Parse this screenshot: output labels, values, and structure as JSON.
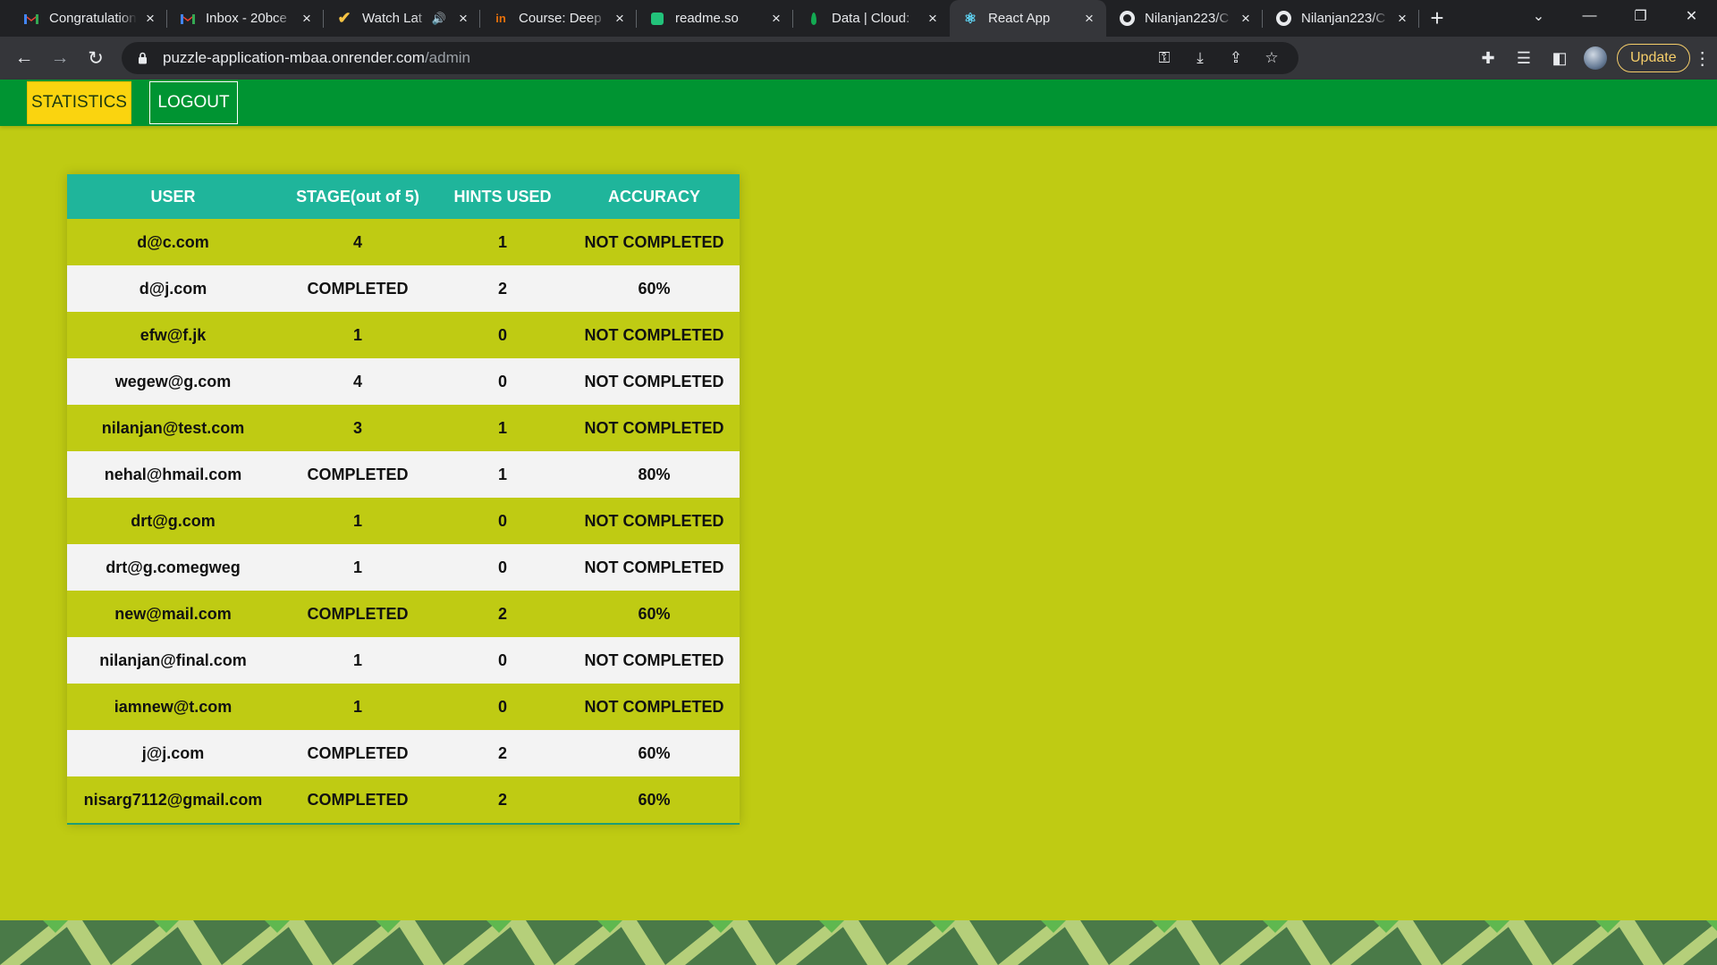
{
  "browser": {
    "tabs": [
      {
        "title": "Congratulation",
        "favicon": "gmail-icon"
      },
      {
        "title": "Inbox - 20bce",
        "favicon": "gmail-icon"
      },
      {
        "title": "Watch Lat",
        "favicon": "check-icon",
        "audio": "🔊"
      },
      {
        "title": "Course: Deep",
        "favicon": "course-icon"
      },
      {
        "title": "readme.so",
        "favicon": "readme-icon"
      },
      {
        "title": "Data | Cloud: ",
        "favicon": "mongodb-leaf-icon"
      },
      {
        "title": "React App",
        "favicon": "react-icon",
        "active": true
      },
      {
        "title": "Nilanjan223/C",
        "favicon": "github-icon"
      },
      {
        "title": "Nilanjan223/C",
        "favicon": "github-icon"
      }
    ],
    "address": {
      "host": "puzzle-application-mbaa.onrender.com",
      "path": "/admin"
    },
    "update_label": "Update"
  },
  "nav": {
    "statistics_label": "STATISTICS",
    "logout_label": "LOGOUT"
  },
  "table": {
    "headers": [
      "USER",
      "STAGE(out of 5)",
      "HINTS USED",
      "ACCURACY"
    ],
    "rows": [
      {
        "user": "d@c.com",
        "stage": "4",
        "hints": "1",
        "accuracy": "NOT COMPLETED"
      },
      {
        "user": "d@j.com",
        "stage": "COMPLETED",
        "hints": "2",
        "accuracy": "60%"
      },
      {
        "user": "efw@f.jk",
        "stage": "1",
        "hints": "0",
        "accuracy": "NOT COMPLETED"
      },
      {
        "user": "wegew@g.com",
        "stage": "4",
        "hints": "0",
        "accuracy": "NOT COMPLETED"
      },
      {
        "user": "nilanjan@test.com",
        "stage": "3",
        "hints": "1",
        "accuracy": "NOT COMPLETED"
      },
      {
        "user": "nehal@hmail.com",
        "stage": "COMPLETED",
        "hints": "1",
        "accuracy": "80%"
      },
      {
        "user": "drt@g.com",
        "stage": "1",
        "hints": "0",
        "accuracy": "NOT COMPLETED"
      },
      {
        "user": "drt@g.comegweg",
        "stage": "1",
        "hints": "0",
        "accuracy": "NOT COMPLETED"
      },
      {
        "user": "new@mail.com",
        "stage": "COMPLETED",
        "hints": "2",
        "accuracy": "60%"
      },
      {
        "user": "nilanjan@final.com",
        "stage": "1",
        "hints": "0",
        "accuracy": "NOT COMPLETED"
      },
      {
        "user": "iamnew@t.com",
        "stage": "1",
        "hints": "0",
        "accuracy": "NOT COMPLETED"
      },
      {
        "user": "j@j.com",
        "stage": "COMPLETED",
        "hints": "2",
        "accuracy": "60%"
      },
      {
        "user": "nisarg7112@gmail.com",
        "stage": "COMPLETED",
        "hints": "2",
        "accuracy": "60%"
      }
    ]
  },
  "colors": {
    "page_bg": "#bfcb13",
    "navbar": "#009432",
    "statistics_button": "#fad40f",
    "table_header": "#1fb59b",
    "row_alt": "#f3f3f3",
    "footer_dark": "#4a7a48",
    "footer_light": "#b5cf7a",
    "footer_accent": "#5fb84f"
  }
}
